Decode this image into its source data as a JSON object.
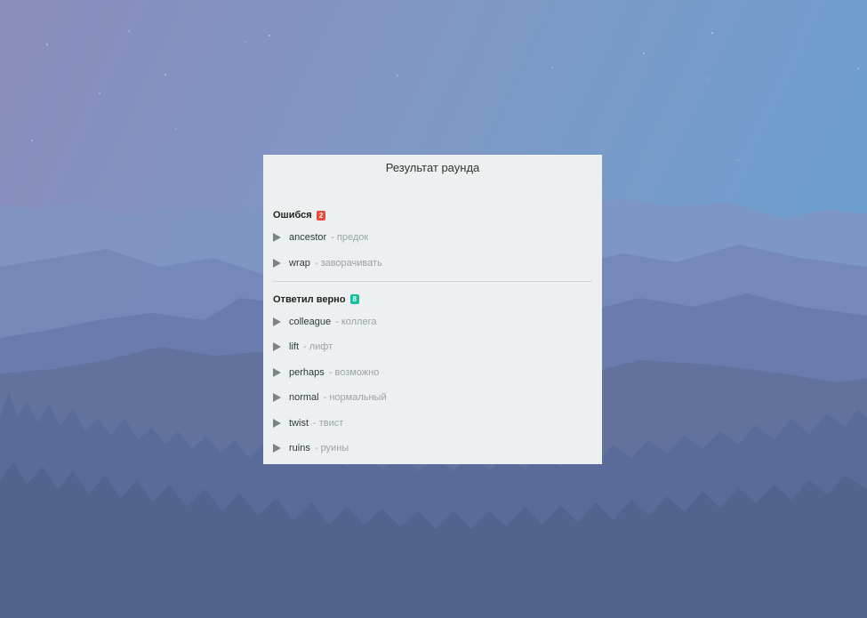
{
  "panel": {
    "title": "Результат раунда"
  },
  "mistakes": {
    "label": "Ошибся",
    "count": "2",
    "badge_color": "#e74c3c",
    "words": [
      {
        "en": "ancestor",
        "ru": "- предок"
      },
      {
        "en": "wrap",
        "ru": "- заворачивать"
      }
    ]
  },
  "correct": {
    "label": "Ответил верно",
    "count": "8",
    "badge_color": "#1abc9c",
    "words": [
      {
        "en": "colleague",
        "ru": "- коллега"
      },
      {
        "en": "lift",
        "ru": "- лифт"
      },
      {
        "en": "perhaps",
        "ru": "- возможно"
      },
      {
        "en": "normal",
        "ru": "- нормальный"
      },
      {
        "en": "twist",
        "ru": "- твист"
      },
      {
        "en": "ruins",
        "ru": "- руины"
      }
    ]
  }
}
